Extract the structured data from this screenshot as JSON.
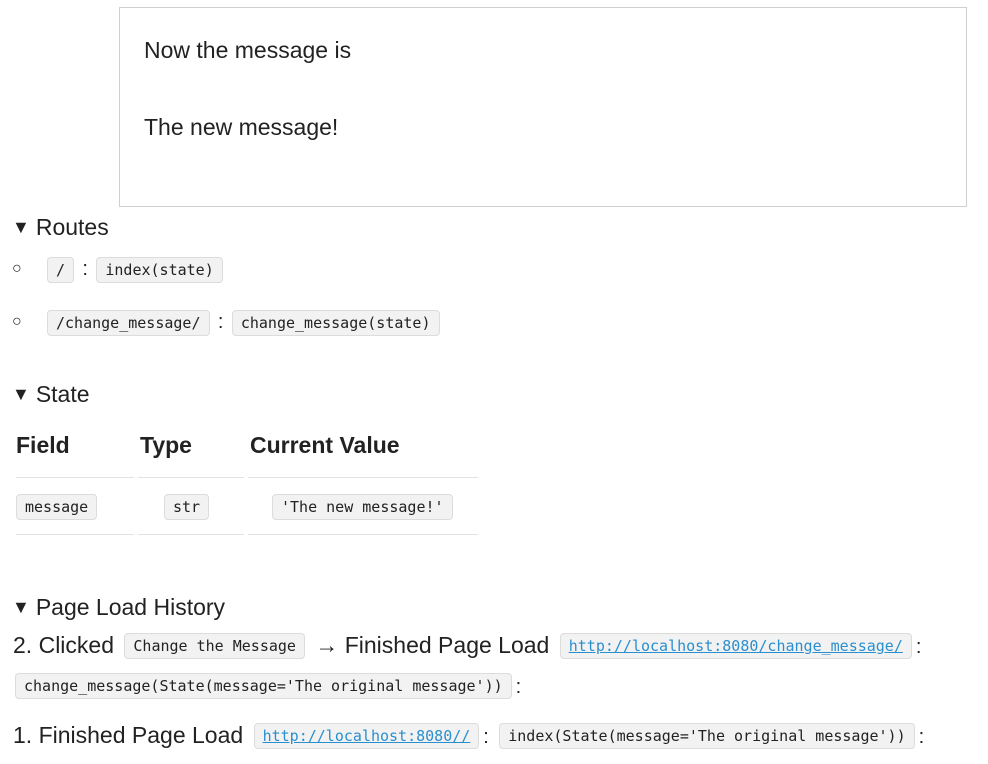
{
  "frame": {
    "line1": "Now the message is",
    "line2": "The new message!"
  },
  "routes": {
    "heading": "Routes",
    "items": [
      {
        "path": "/",
        "handler": "index(state)"
      },
      {
        "path": "/change_message/",
        "handler": "change_message(state)"
      }
    ]
  },
  "state": {
    "heading": "State",
    "columns": [
      "Field",
      "Type",
      "Current Value"
    ],
    "rows": [
      {
        "field": "message",
        "type": "str",
        "value": "'The new message!'"
      }
    ]
  },
  "history": {
    "heading": "Page Load History",
    "entries": [
      {
        "number": "2.",
        "action": "Clicked",
        "button": "Change the Message",
        "arrow": "→",
        "event": "Finished Page Load",
        "url": "http://localhost:8080/change_message/",
        "call": "change_message(State(message='The original message'))"
      },
      {
        "number": "1.",
        "event": "Finished Page Load",
        "url": "http://localhost:8080//",
        "call": "index(State(message='The original message'))"
      }
    ]
  },
  "icons": {
    "disclosure": "triangle-down-icon",
    "bullet": "hollow-circle-bullet-icon"
  }
}
